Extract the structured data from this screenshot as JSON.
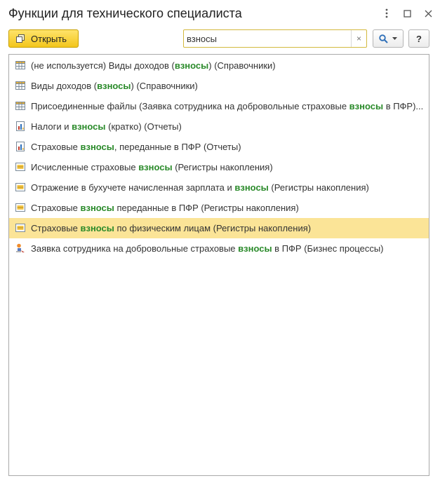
{
  "window": {
    "title": "Функции для технического специалиста"
  },
  "toolbar": {
    "open_label": "Открыть",
    "search_value": "взносы",
    "clear_label": "×",
    "help_label": "?"
  },
  "colors": {
    "accent_button": "#f3c61c",
    "highlight_text": "#2a8a2a",
    "selected_row": "#fbe497"
  },
  "results": [
    {
      "icon": "table-icon",
      "before": "(не используется) Виды доходов (",
      "match": "взносы",
      "after": ") (Справочники)",
      "selected": false
    },
    {
      "icon": "table-icon",
      "before": "Виды доходов (",
      "match": "взносы",
      "after": ") (Справочники)",
      "selected": false
    },
    {
      "icon": "table-icon",
      "before": "Присоединенные файлы (Заявка сотрудника на добровольные страховые ",
      "match": "взносы",
      "after": " в ПФР)...",
      "selected": false
    },
    {
      "icon": "report-icon",
      "before": "Налоги и ",
      "match": "взносы",
      "after": " (кратко) (Отчеты)",
      "selected": false
    },
    {
      "icon": "report-icon",
      "before": "Страховые ",
      "match": "взносы",
      "after": ", переданные в ПФР (Отчеты)",
      "selected": false
    },
    {
      "icon": "register-icon",
      "before": "Исчисленные страховые ",
      "match": "взносы",
      "after": " (Регистры накопления)",
      "selected": false
    },
    {
      "icon": "register-icon",
      "before": "Отражение в бухучете начисленная зарплата и ",
      "match": "взносы",
      "after": " (Регистры накопления)",
      "selected": false
    },
    {
      "icon": "register-icon",
      "before": "Страховые ",
      "match": "взносы",
      "after": " переданные в ПФР (Регистры накопления)",
      "selected": false
    },
    {
      "icon": "register-icon",
      "before": "Страховые ",
      "match": "взносы",
      "after": " по физическим лицам (Регистры накопления)",
      "selected": true
    },
    {
      "icon": "business-process-icon",
      "before": "Заявка сотрудника на добровольные страховые ",
      "match": "взносы",
      "after": " в ПФР (Бизнес процессы)",
      "selected": false
    }
  ]
}
